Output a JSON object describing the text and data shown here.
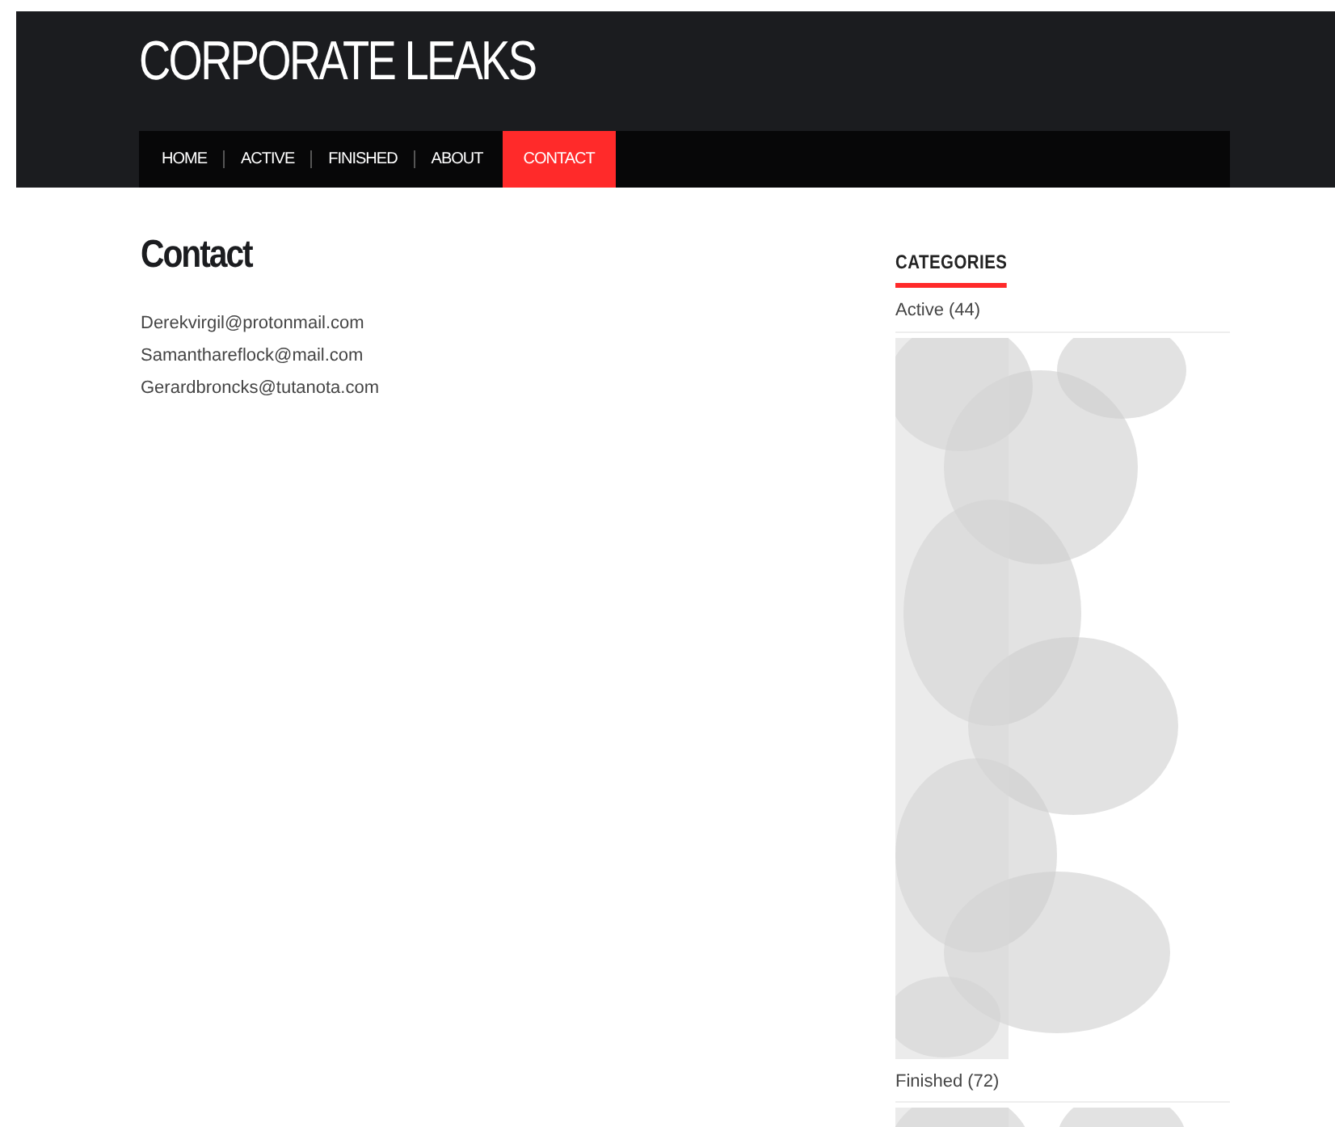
{
  "site_title": "CORPORATE LEAKS",
  "nav": [
    {
      "label": "HOME",
      "selected": false
    },
    {
      "label": "ACTIVE",
      "selected": false
    },
    {
      "label": "FINISHED",
      "selected": false
    },
    {
      "label": "ABOUT",
      "selected": false
    },
    {
      "label": "CONTACT",
      "selected": true
    }
  ],
  "page_title": "Contact",
  "emails": [
    "Derekvirgil@protonmail.com",
    "Samanthareflock@mail.com",
    "Gerardbroncks@tutanota.com"
  ],
  "sidebar": {
    "heading": "CATEGORIES",
    "categories": [
      {
        "label": "Active (44)"
      },
      {
        "label": "Finished (72)"
      }
    ]
  }
}
